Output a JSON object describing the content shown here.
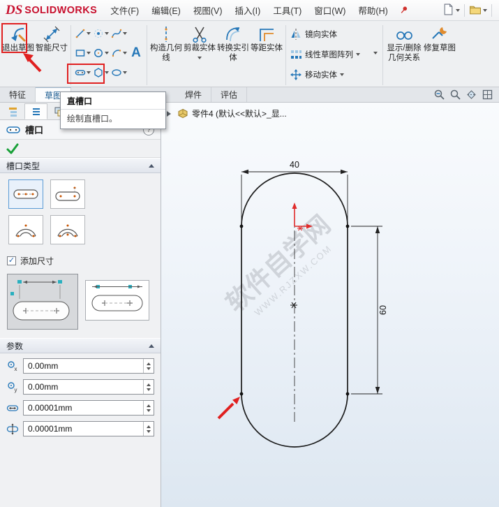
{
  "menubar": {
    "logo_ds": "DS",
    "logo_name": "SOLIDWORKS",
    "items": [
      "文件(F)",
      "编辑(E)",
      "视图(V)",
      "插入(I)",
      "工具(T)",
      "窗口(W)",
      "帮助(H)"
    ]
  },
  "toolbar": {
    "exit_sketch": "退出草图",
    "smart_dimension": "智能尺寸",
    "text_tool": "A",
    "construction_geometry": "构造几何线",
    "trim_entities": "剪裁实体",
    "convert_entities": "转换实引体",
    "offset_entities": "等距实体",
    "mirror_entities": "镜向实体",
    "linear_sketch_pattern": "线性草图阵列",
    "move_entities": "移动实体",
    "display_delete_relations": "显示/删除几何关系",
    "repair_sketch": "修复草图"
  },
  "tabs": {
    "features": "特征",
    "sketch": "草图",
    "weldments": "焊件",
    "evaluate": "评估"
  },
  "tooltip": {
    "title": "直槽口",
    "description": "绘制直槽口。"
  },
  "feature_tree": {
    "part": "零件4 (默认<<默认>_显..."
  },
  "panel": {
    "title": "槽口",
    "help": "?",
    "slot_type_label": "槽口类型",
    "add_dimension_label": "添加尺寸",
    "parameters_label": "参数",
    "params": [
      {
        "name": "center-x",
        "value": "0.00mm"
      },
      {
        "name": "center-y",
        "value": "0.00mm"
      },
      {
        "name": "slot-length",
        "value": "0.00001mm"
      },
      {
        "name": "slot-width",
        "value": "0.00001mm"
      }
    ]
  },
  "drawing": {
    "width_dim": "40",
    "height_dim": "60"
  },
  "watermark": {
    "line1": "软件自学网",
    "line2": "WWW.RJZXW.COM"
  }
}
